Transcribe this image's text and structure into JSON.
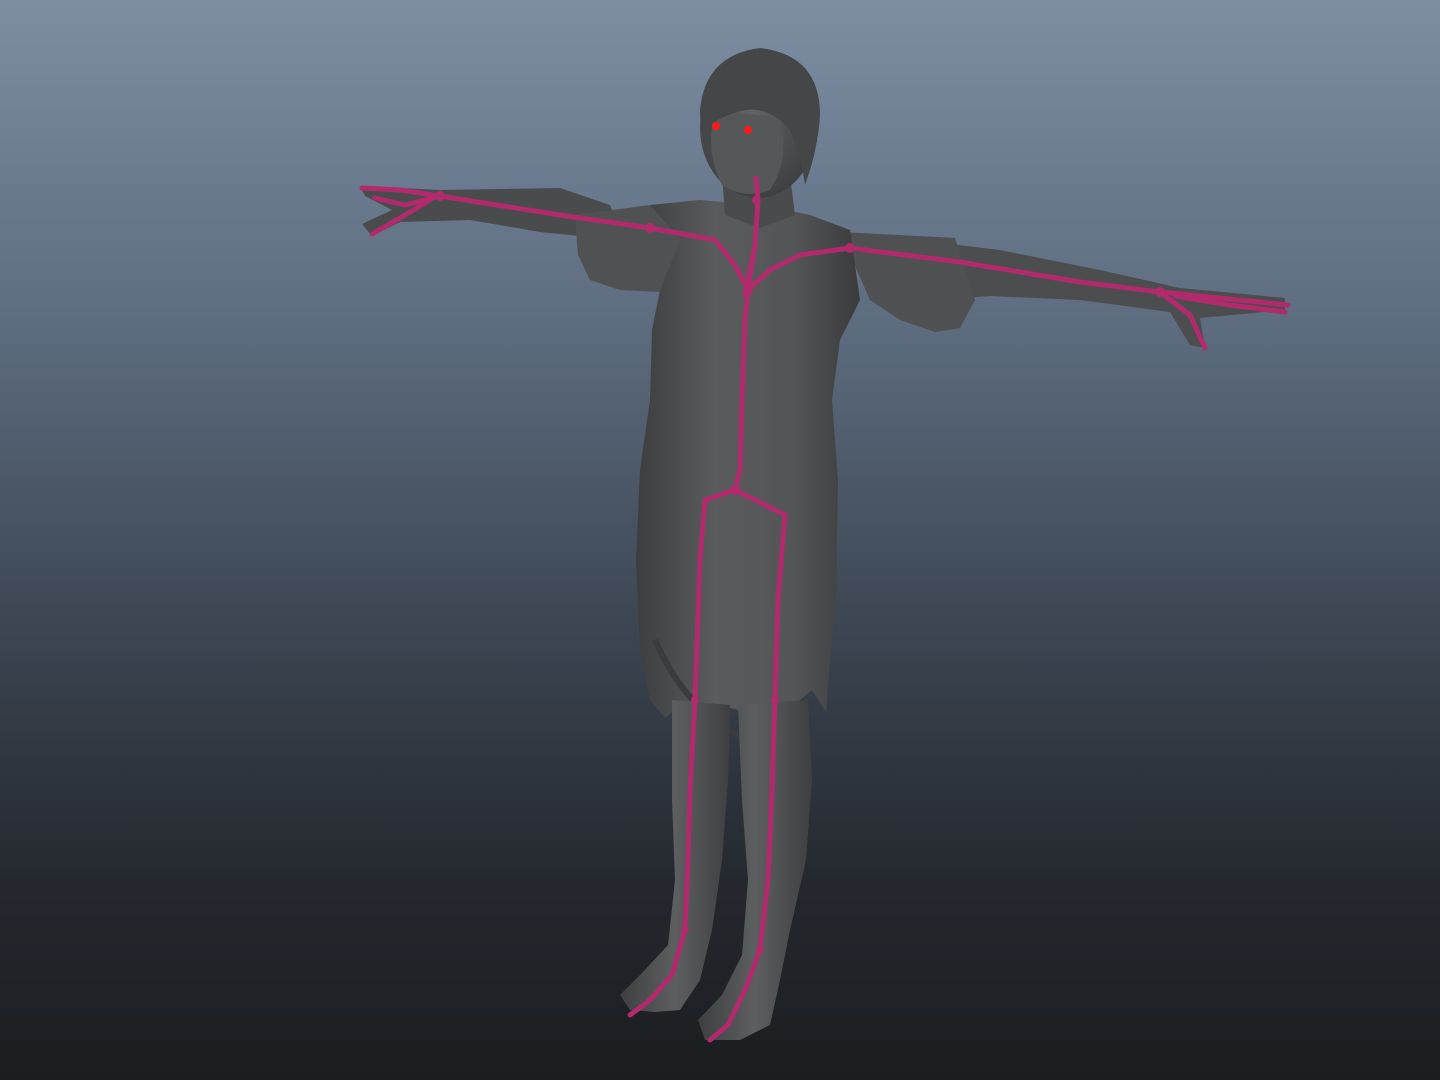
{
  "viewport": {
    "background_top": "#7d8ea3",
    "background_bottom": "#1b1d20"
  },
  "model": {
    "shading_color": "#555658",
    "shading_dark": "#3c3d3f",
    "skeleton_color": "#b12a6c",
    "eye_color": "#ff1a1a",
    "pose": "T-pose"
  }
}
